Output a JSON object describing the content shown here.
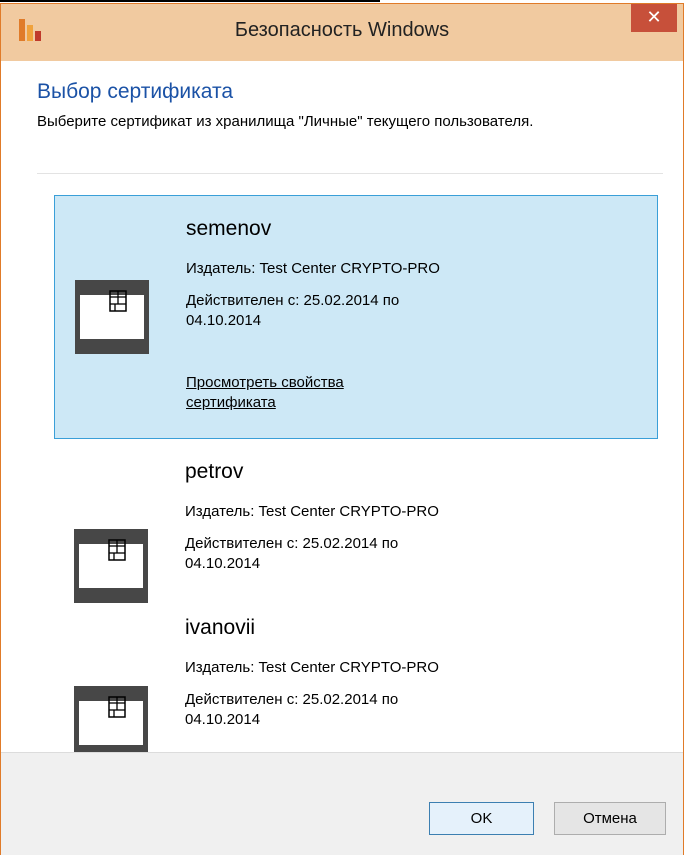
{
  "window": {
    "title": "Безопасность Windows",
    "close_glyph": "✕"
  },
  "dialog": {
    "heading": "Выбор сертификата",
    "description": "Выберите сертификат из хранилища \"Личные\" текущего пользователя."
  },
  "certificates": [
    {
      "name": "semenov",
      "issuer": "Издатель: Test Center CRYPTO-PRO",
      "validity": "Действителен с: 25.02.2014 по 04.10.2014",
      "link": "Просмотреть свойства сертификата",
      "selected": true,
      "icon": "certificate-card-icon"
    },
    {
      "name": "petrov",
      "issuer": "Издатель: Test Center CRYPTO-PRO",
      "validity": "Действителен с: 25.02.2014 по 04.10.2014",
      "selected": false,
      "icon": "certificate-card-icon"
    },
    {
      "name": "ivanovii",
      "issuer": "Издатель: Test Center CRYPTO-PRO",
      "validity": "Действителен с: 25.02.2014 по 04.10.2014",
      "selected": false,
      "icon": "certificate-card-icon"
    }
  ],
  "buttons": {
    "ok": "OK",
    "cancel": "Отмена"
  },
  "colors": {
    "titlebar": "#f1caa0",
    "window_border": "#e07b29",
    "close": "#c7503a",
    "heading": "#1b52a6",
    "selected_bg": "#cde8f6",
    "selected_border": "#3a9fd8"
  }
}
